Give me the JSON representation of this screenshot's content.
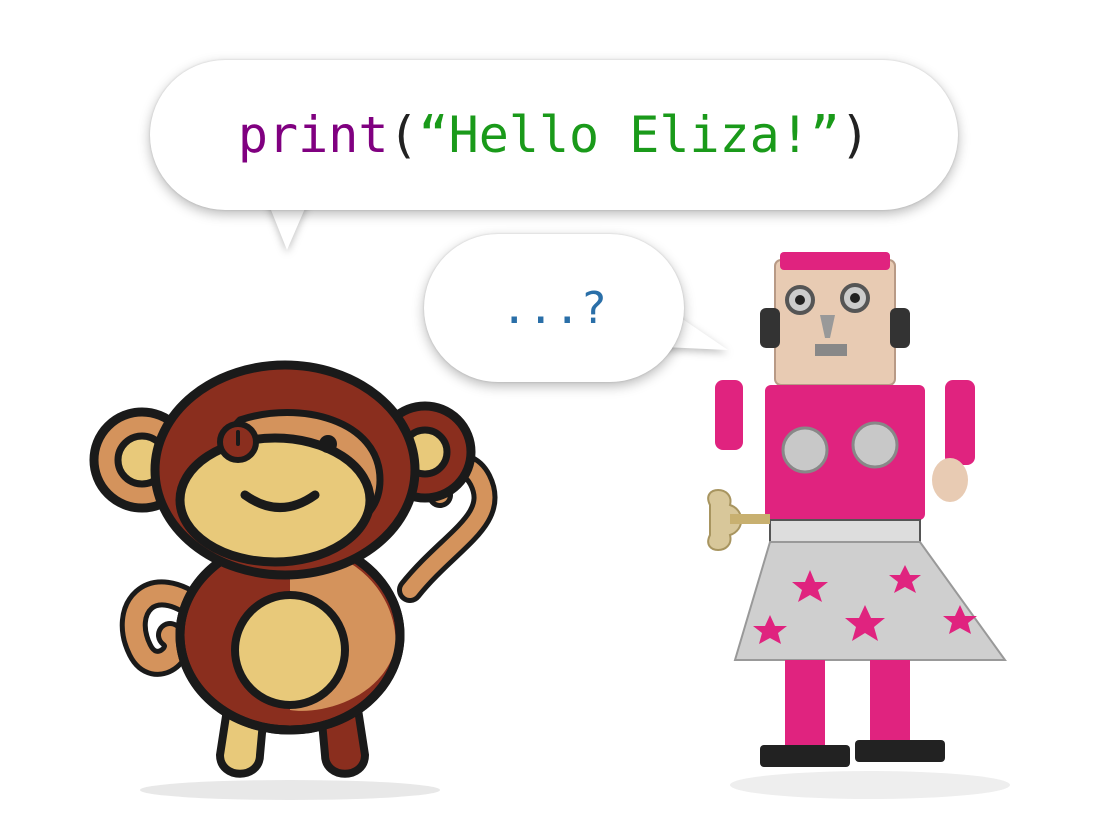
{
  "speech": {
    "main": {
      "func": "print",
      "open_paren": "(",
      "string": "“Hello Eliza!”",
      "close_paren": ")"
    },
    "reply": "...?"
  },
  "colors": {
    "func": "#800080",
    "paren": "#222222",
    "string": "#1a9a1a",
    "reply": "#2a6fa8"
  },
  "characters": {
    "left": "monkey-illustration",
    "right": "robot-photo"
  }
}
